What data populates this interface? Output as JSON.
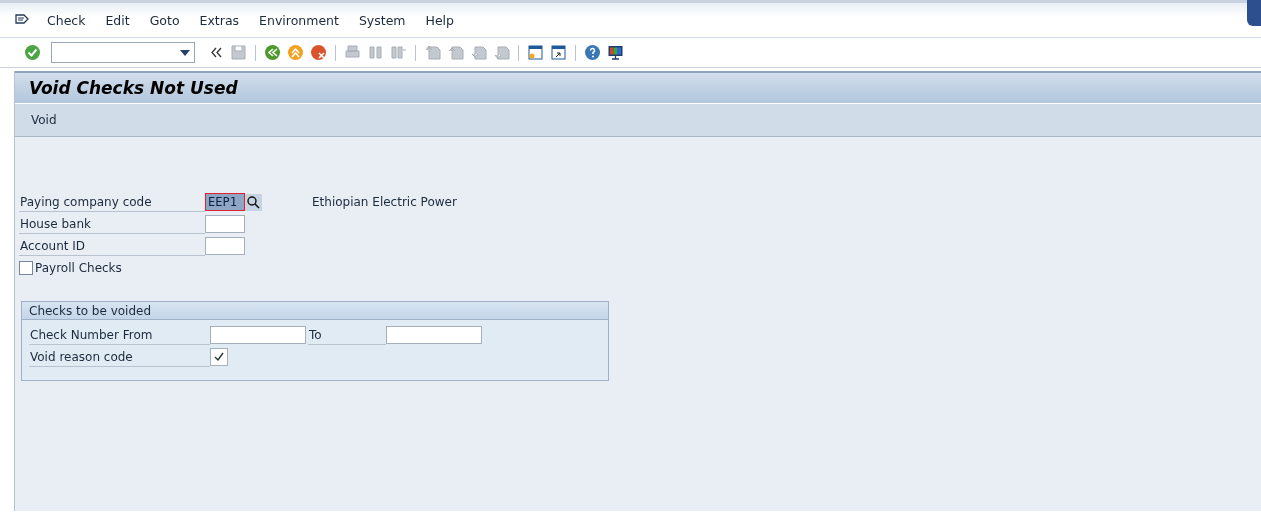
{
  "menu": [
    "Check",
    "Edit",
    "Goto",
    "Extras",
    "Environment",
    "System",
    "Help"
  ],
  "title": "Void Checks Not Used",
  "app_toolbar": [
    "Void"
  ],
  "fields": [
    {
      "label": "Paying company code",
      "value": "EEP1",
      "focused": true,
      "search_help": true,
      "description": "Ethiopian Electric Power"
    },
    {
      "label": "House bank",
      "focused": false,
      "search_help": false
    },
    {
      "label": "Account ID",
      "focused": false,
      "search_help": false
    }
  ],
  "payroll_checks": {
    "label": "Payroll Checks",
    "checked": false
  },
  "group": {
    "title": "Checks to be voided",
    "from_label": "Check Number From",
    "to_label": "To",
    "reason_label": "Void reason code",
    "reason_checked": true
  }
}
